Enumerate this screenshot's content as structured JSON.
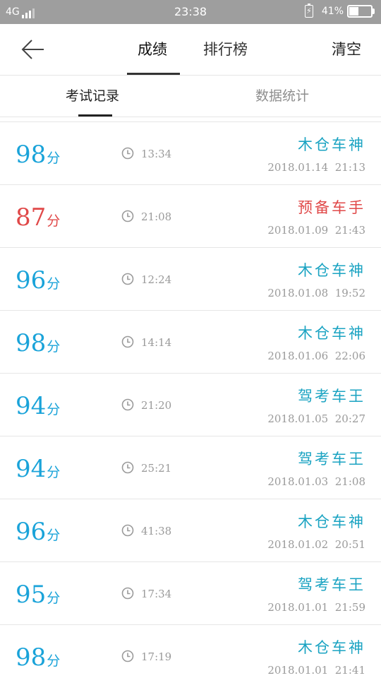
{
  "status_bar": {
    "network": "4G",
    "time": "23:38",
    "battery": "41%",
    "battery_level": 0.41
  },
  "header": {
    "tabs": [
      {
        "label": "成绩",
        "active": true
      },
      {
        "label": "排行榜",
        "active": false
      }
    ],
    "clear_label": "清空"
  },
  "subtabs": [
    {
      "label": "考试记录",
      "active": true
    },
    {
      "label": "数据统计",
      "active": false
    }
  ],
  "colors": {
    "blue": "#1aa3d9",
    "red": "#e04848",
    "teal": "#1aa3c2",
    "gray": "#9a9a9a"
  },
  "records": [
    {
      "score": "98",
      "unit": "分",
      "duration": "13:34",
      "title": "木仓车神",
      "datetime": "2018.01.14  21:13",
      "score_color": "#1aa3d9",
      "title_color": "#1aa3c2"
    },
    {
      "score": "87",
      "unit": "分",
      "duration": "21:08",
      "title": "预备车手",
      "datetime": "2018.01.09  21:43",
      "score_color": "#e04848",
      "title_color": "#e04848"
    },
    {
      "score": "96",
      "unit": "分",
      "duration": "12:24",
      "title": "木仓车神",
      "datetime": "2018.01.08  19:52",
      "score_color": "#1aa3d9",
      "title_color": "#1aa3c2"
    },
    {
      "score": "98",
      "unit": "分",
      "duration": "14:14",
      "title": "木仓车神",
      "datetime": "2018.01.06  22:06",
      "score_color": "#1aa3d9",
      "title_color": "#1aa3c2"
    },
    {
      "score": "94",
      "unit": "分",
      "duration": "21:20",
      "title": "驾考车王",
      "datetime": "2018.01.05  20:27",
      "score_color": "#1aa3d9",
      "title_color": "#1aa3c2"
    },
    {
      "score": "94",
      "unit": "分",
      "duration": "25:21",
      "title": "驾考车王",
      "datetime": "2018.01.03  21:08",
      "score_color": "#1aa3d9",
      "title_color": "#1aa3c2"
    },
    {
      "score": "96",
      "unit": "分",
      "duration": "41:38",
      "title": "木仓车神",
      "datetime": "2018.01.02  20:51",
      "score_color": "#1aa3d9",
      "title_color": "#1aa3c2"
    },
    {
      "score": "95",
      "unit": "分",
      "duration": "17:34",
      "title": "驾考车王",
      "datetime": "2018.01.01  21:59",
      "score_color": "#1aa3d9",
      "title_color": "#1aa3c2"
    },
    {
      "score": "98",
      "unit": "分",
      "duration": "17:19",
      "title": "木仓车神",
      "datetime": "2018.01.01  21:41",
      "score_color": "#1aa3d9",
      "title_color": "#1aa3c2"
    }
  ]
}
